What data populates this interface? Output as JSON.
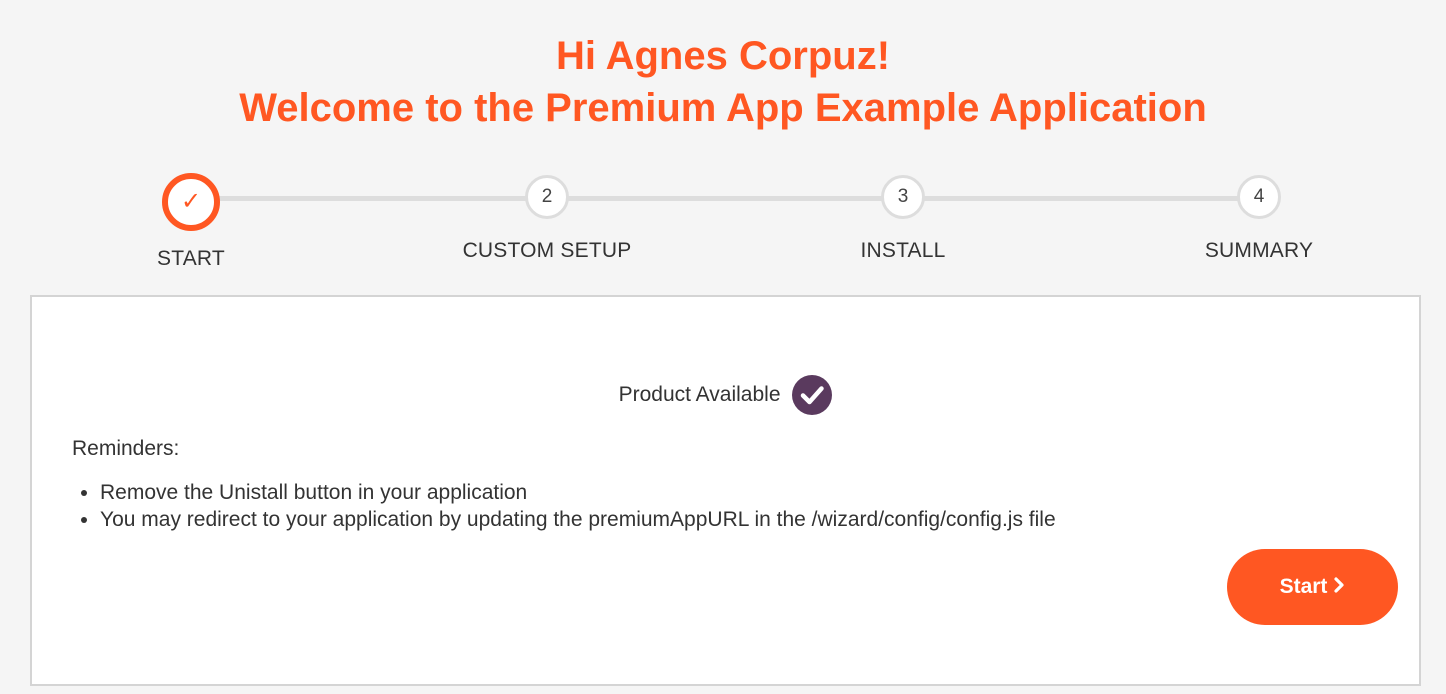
{
  "header": {
    "greeting": "Hi Agnes Corpuz!",
    "welcome": "Welcome to the Premium App Example Application"
  },
  "colors": {
    "accent": "#ff5722",
    "badge": "#5a3a5e",
    "track": "#dddddd"
  },
  "stepper": {
    "steps": [
      {
        "marker": "✓",
        "label": "START",
        "state": "completed"
      },
      {
        "marker": "2",
        "label": "CUSTOM SETUP",
        "state": "pending"
      },
      {
        "marker": "3",
        "label": "INSTALL",
        "state": "pending"
      },
      {
        "marker": "4",
        "label": "SUMMARY",
        "state": "pending"
      }
    ]
  },
  "card": {
    "availability_text": "Product Available",
    "availability_icon": "check-circle-icon",
    "reminders_title": "Reminders:",
    "reminders": [
      "Remove the Unistall button in your application",
      "You may redirect to your application by updating the premiumAppURL in the /wizard/config/config.js file"
    ],
    "start_label": "Start",
    "start_icon": "chevron-right-icon"
  }
}
